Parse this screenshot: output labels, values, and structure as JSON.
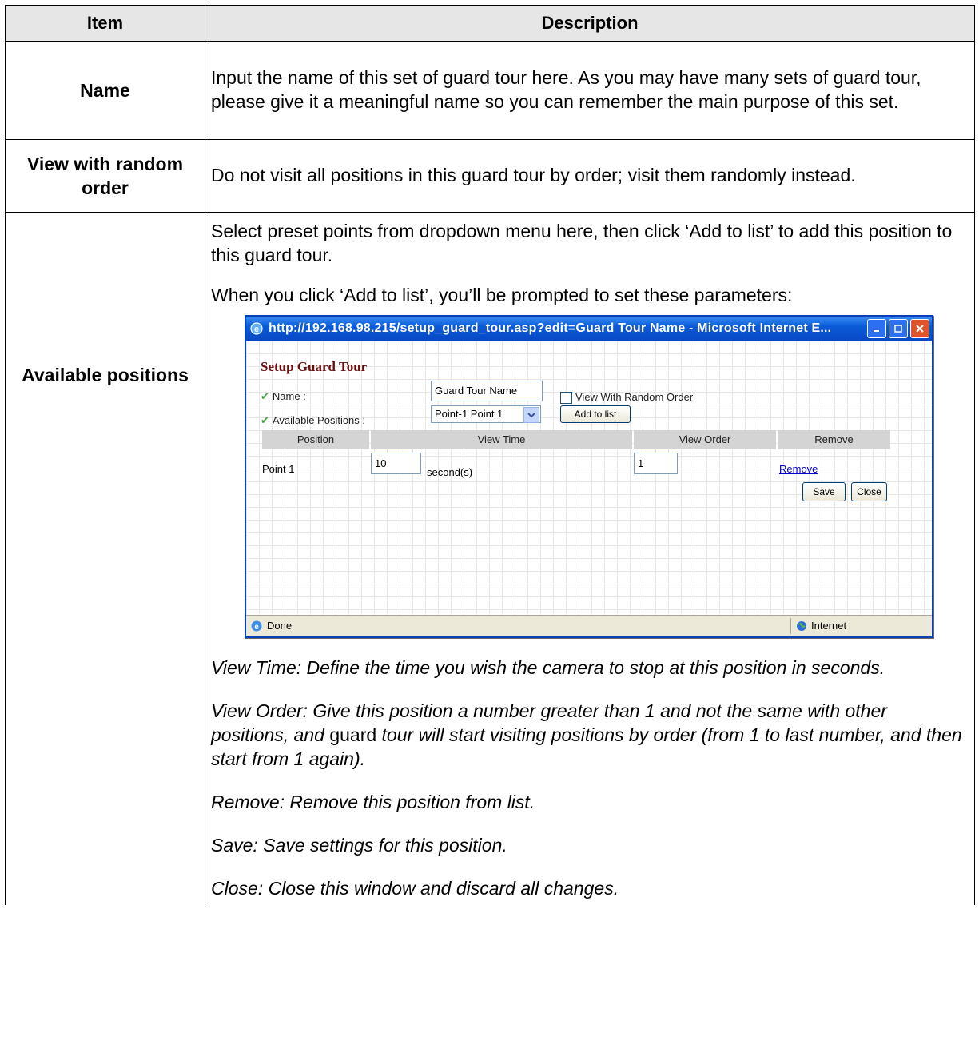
{
  "table": {
    "header_item": "Item",
    "header_description": "Description",
    "rows": [
      {
        "item": "Name",
        "description": "Input the name of this set of guard tour here. As you may have many sets of guard tour, please give it a meaningful name so you can remember the main purpose of this set."
      },
      {
        "item": "View with random order",
        "description": "Do not visit all positions in this guard tour by order; visit them randomly instead."
      },
      {
        "item": "Available positions",
        "intro_1": "Select preset points from dropdown menu here, then click ‘Add to list’ to add this position to this guard tour.",
        "intro_2": "When you click ‘Add to list’, you’ll be prompted to set these parameters:",
        "view_time": "View Time: Define the time you wish the camera to stop at this position in seconds.",
        "view_order_a": "View Order: Give this position a number greater than 1 and not the same with other positions, and ",
        "view_order_b": "guard",
        "view_order_c": " tour will start visiting positions by order (from 1 to last number, and then start from 1 again).",
        "remove": "Remove: Remove this position from list.",
        "save": "Save: Save settings for this position.",
        "close": "Close: Close this window and discard all changes."
      }
    ]
  },
  "window": {
    "title": "http://192.168.98.215/setup_guard_tour.asp?edit=Guard Tour Name - Microsoft Internet E...",
    "heading": "Setup Guard Tour",
    "name_label": "Name :",
    "name_value": "Guard Tour Name",
    "random_label": "View With Random Order",
    "positions_label": "Available Positions :",
    "positions_selected": "Point-1  Point 1",
    "add_button": "Add to list",
    "columns": [
      "Position",
      "View Time",
      "View Order",
      "Remove"
    ],
    "row": {
      "position": "Point 1",
      "view_time": "10",
      "unit": "second(s)",
      "view_order": "1",
      "remove": "Remove"
    },
    "save_button": "Save",
    "close_button": "Close",
    "status_left": "Done",
    "status_right": "Internet"
  }
}
